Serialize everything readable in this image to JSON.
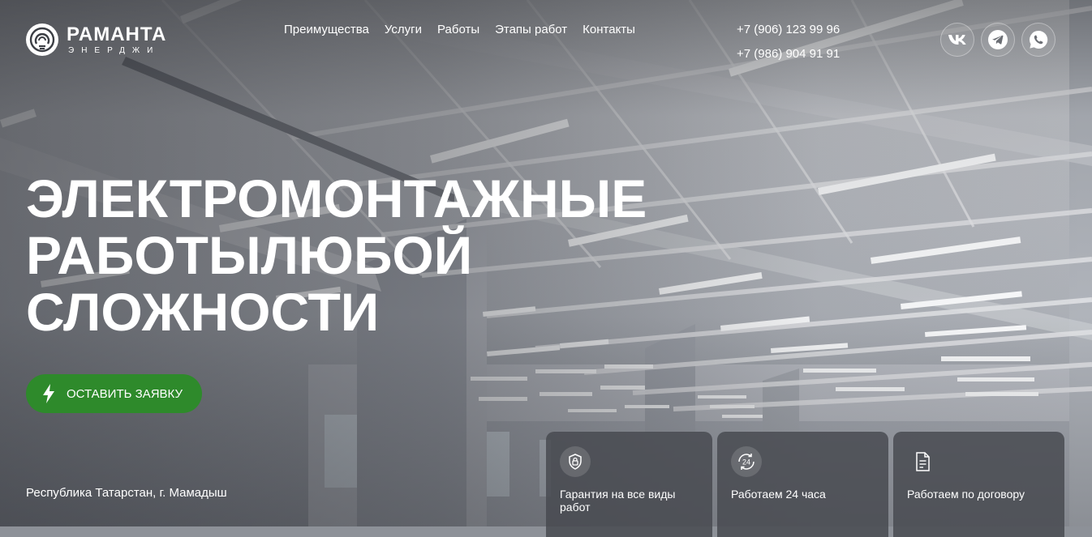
{
  "brand": {
    "name": "РАМАНТА",
    "tagline": "ЭНЕРДЖИ"
  },
  "nav": {
    "items": [
      {
        "label": "Преимущества"
      },
      {
        "label": "Услуги"
      },
      {
        "label": "Работы"
      },
      {
        "label": "Этапы работ"
      },
      {
        "label": "Контакты"
      }
    ]
  },
  "contacts": {
    "phone1": "+7 (906) 123 99 96",
    "phone2": "+7 (986) 904 91 91"
  },
  "socials": [
    {
      "icon": "vk-icon"
    },
    {
      "icon": "telegram-icon"
    },
    {
      "icon": "whatsapp-icon"
    }
  ],
  "hero": {
    "title_line1": "ЭЛЕКТРОМОНТАЖНЫЕ",
    "title_line2": "РАБОТЫЛЮБОЙ",
    "title_line3": "СЛОЖНОСТИ",
    "cta_label": "ОСТАВИТЬ ЗАЯВКУ",
    "cta_icon": "lightning-icon"
  },
  "location": "Республика Татарстан, г. Мамадыш",
  "features": [
    {
      "icon": "shield-lock-icon",
      "text": "Гарантия на все виды работ"
    },
    {
      "icon": "clock-24-icon",
      "text": "Работаем 24 часа"
    },
    {
      "icon": "document-icon",
      "text": "Работаем по договору"
    }
  ],
  "colors": {
    "accent": "#2e8a2b",
    "text": "#ffffff",
    "card_bg": "#46484e"
  }
}
